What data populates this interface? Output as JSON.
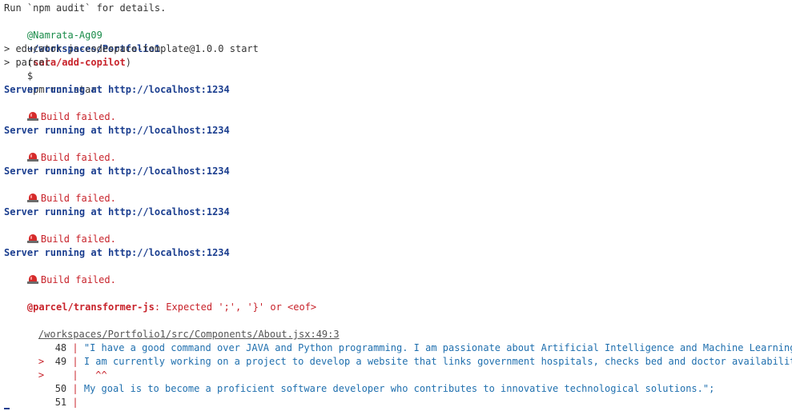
{
  "audit_hint": "Run `npm audit` for details.",
  "prompt": {
    "user": "@Namrata-Ag09",
    "arrow": "➜",
    "path": "/workspaces/Portfolio1",
    "branch_open": "(",
    "branch": "sara/add-copilot",
    "branch_close": ")",
    "dollar": "$",
    "command": "npm run start"
  },
  "script_lines": [
    "> educator-js-codespace-template@1.0.0 start",
    "> parcel"
  ],
  "server_message": "Server running at http://localhost:1234",
  "build_failed": "Build failed.",
  "error": {
    "plugin": "@parcel/transformer-js",
    "message": ": Expected ';', '}' or <eof>",
    "file": "/workspaces/Portfolio1/src/Components/About.jsx:49:3"
  },
  "code_frame": [
    {
      "marker": " ",
      "number": "48",
      "text": "\"I have a good command over JAVA and Python programming. I am passionate about Artificial Intelligence and Machine Learning, and I"
    },
    {
      "marker": ">",
      "number": "49",
      "text": "I am currently working on a project to develop a website that links government hospitals, checks bed and doctor availability in ru"
    },
    {
      "marker": ">",
      "number": "",
      "text": "  ^^"
    },
    {
      "marker": " ",
      "number": "50",
      "text": "My goal is to become a proficient software developer who contributes to innovative technological solutions.\";"
    },
    {
      "marker": " ",
      "number": "51",
      "text": ""
    }
  ],
  "colors": {
    "prompt_user": "#1a8c4a",
    "path": "#1b3e8f",
    "branch": "#c8232b",
    "error": "#c8232b",
    "code": "#1f6fae"
  }
}
